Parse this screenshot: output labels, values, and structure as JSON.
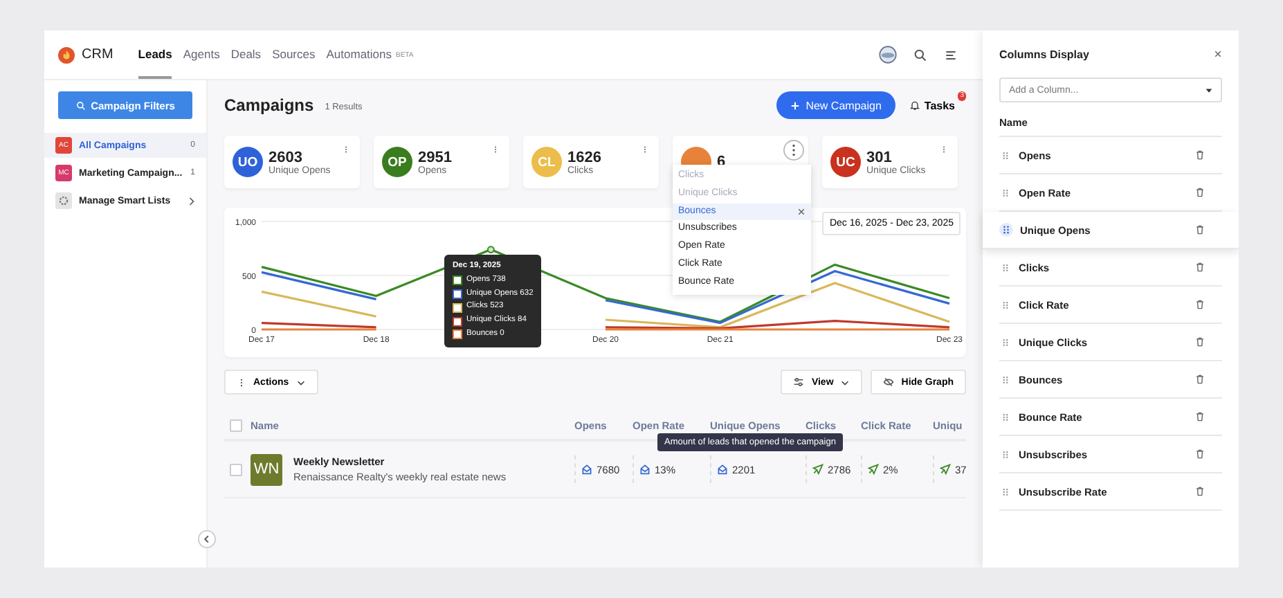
{
  "nav": {
    "brand": "CRM",
    "tabs": [
      {
        "label": "Leads",
        "selected": true
      },
      {
        "label": "Agents",
        "selected": false
      },
      {
        "label": "Deals",
        "selected": false
      },
      {
        "label": "Sources",
        "selected": false
      },
      {
        "label": "Automations",
        "selected": false,
        "badge": "BETA"
      }
    ]
  },
  "sidebar": {
    "filter_button": "Campaign Filters",
    "items": [
      {
        "kind": "list",
        "initials": "AC",
        "label": "All Campaigns",
        "count": "0",
        "color": "#e0463a",
        "selected": true
      },
      {
        "kind": "list",
        "initials": "MC",
        "label": "Marketing Campaign...",
        "count": "1",
        "color": "#d63a6a",
        "selected": false
      },
      {
        "kind": "settings",
        "label": "Manage Smart Lists",
        "selected": false
      }
    ]
  },
  "header": {
    "title": "Campaigns",
    "results": "1 Results",
    "new_button": "New Campaign",
    "tasks": "Tasks",
    "tasks_badge": "3"
  },
  "cards": [
    {
      "initials": "UO",
      "value": "2603",
      "label": "Unique Opens",
      "color": "#2f62d8",
      "menu_open": false
    },
    {
      "initials": "OP",
      "value": "2951",
      "label": "Opens",
      "color": "#3a7d1f",
      "menu_open": false
    },
    {
      "initials": "CL",
      "value": "1626",
      "label": "Clicks",
      "color": "#ecbd4a",
      "menu_open": false
    },
    {
      "value": "6",
      "color": "#e8823a",
      "menu_open": true
    },
    {
      "initials": "UC",
      "value": "301",
      "label": "Unique Clicks",
      "color": "#c8321e",
      "menu_open": false
    }
  ],
  "metric_menu": [
    {
      "label": "Clicks",
      "disabled": true,
      "selected": false
    },
    {
      "label": "Unique Clicks",
      "disabled": true,
      "selected": false
    },
    {
      "label": "Bounces",
      "disabled": false,
      "selected": true
    },
    {
      "label": "Unsubscribes",
      "disabled": false,
      "selected": false
    },
    {
      "label": "Open Rate",
      "disabled": false,
      "selected": false
    },
    {
      "label": "Click Rate",
      "disabled": false,
      "selected": false
    },
    {
      "label": "Bounce Rate",
      "disabled": false,
      "selected": false
    }
  ],
  "date_range": "Dec 16, 2025 - Dec 23, 2025",
  "chart_data": {
    "type": "line",
    "categories": [
      "Dec 17",
      "Dec 18",
      null,
      "Dec 20",
      "Dec 21",
      null,
      "Dec 23"
    ],
    "ylim": [
      0,
      1000
    ],
    "yticks": [
      0,
      500,
      {
        "value": 1000,
        "label": "1,000"
      }
    ],
    "series": [
      {
        "name": "Opens",
        "color": "#3a8a25",
        "values": [
          580,
          310,
          740,
          290,
          70,
          600,
          290
        ]
      },
      {
        "name": "Unique Opens",
        "color": "#3568d4",
        "values": [
          530,
          280,
          null,
          270,
          60,
          540,
          240
        ]
      },
      {
        "name": "Clicks",
        "color": "#d8b85a",
        "values": [
          350,
          120,
          null,
          90,
          20,
          430,
          70
        ]
      },
      {
        "name": "Unique Clicks",
        "color": "#c0392b",
        "values": [
          60,
          20,
          null,
          20,
          10,
          80,
          20
        ]
      },
      {
        "name": "Bounces",
        "color": "#e8823a",
        "values": [
          0,
          0,
          null,
          0,
          0,
          0,
          0
        ]
      }
    ]
  },
  "chart_tooltip": {
    "title": "Dec 19, 2025",
    "items": [
      {
        "value": "738",
        "color": "#3a8a25"
      },
      {
        "value": "632",
        "color": "#3568d4"
      },
      {
        "value": "523",
        "color": "#d8b85a"
      },
      {
        "value": "84",
        "color": "#c0392b"
      },
      {
        "value": "0",
        "color": "#e8823a"
      }
    ]
  },
  "toolbar": {
    "actions": "Actions",
    "view": "View",
    "hide_graph": "Hide Graph"
  },
  "table": {
    "select_all_checked": false,
    "columns": [
      "Name",
      "Opens",
      "Open Rate",
      "Unique Opens",
      "Clicks",
      "Click Rate",
      "Uniqu"
    ],
    "header_tooltip": "Amount of leads that opened the campaign",
    "rows": [
      {
        "checked": false,
        "cells": [
          {
            "kind": "campaign",
            "initials": "WN",
            "name": "Weekly Newsletter",
            "description": "Renaissance Realty's weekly real estate news"
          },
          {
            "kind": "open",
            "value": "7680"
          },
          {
            "kind": "open",
            "value": "13%"
          },
          {
            "kind": "open",
            "value": "2201"
          },
          {
            "kind": "click",
            "value": "2786"
          },
          {
            "kind": "click",
            "value": "2%"
          },
          {
            "kind": "click",
            "value": "37"
          }
        ]
      }
    ]
  },
  "columns_panel": {
    "title": "Columns Display",
    "placeholder": "Add a Column...",
    "heading": "Name",
    "items": [
      {
        "label": "Opens",
        "dragging": false
      },
      {
        "label": "Open Rate",
        "dragging": false
      },
      {
        "label": "Unique Opens",
        "dragging": true
      },
      {
        "label": "Clicks",
        "dragging": false
      },
      {
        "label": "Click Rate",
        "dragging": false
      },
      {
        "label": "Unique Clicks",
        "dragging": false
      },
      {
        "label": "Bounces",
        "dragging": false
      },
      {
        "label": "Bounce Rate",
        "dragging": false
      },
      {
        "label": "Unsubscribes",
        "dragging": false
      },
      {
        "label": "Unsubscribe Rate",
        "dragging": false
      }
    ]
  }
}
